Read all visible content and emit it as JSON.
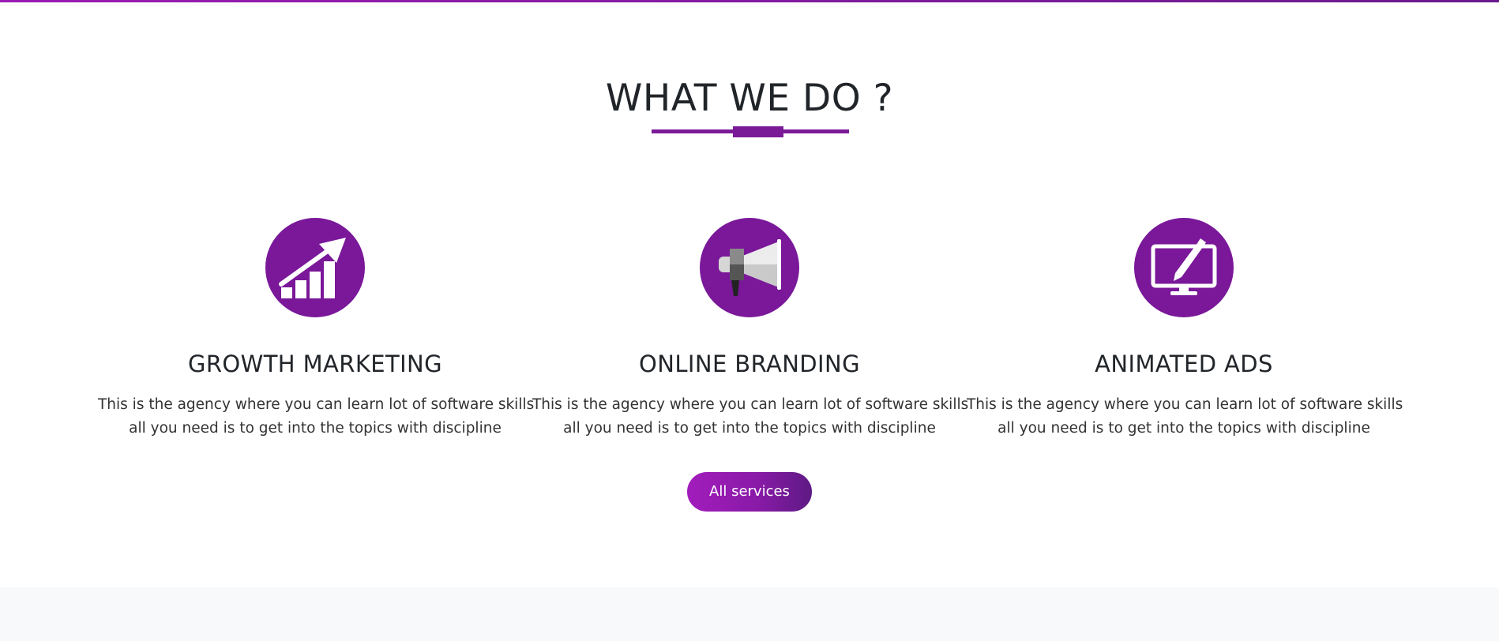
{
  "section": {
    "title": "WHAT WE DO ?"
  },
  "services": [
    {
      "icon": "growth-chart-icon",
      "title": "GROWTH MARKETING",
      "desc_line1": "This is the agency where you can learn lot of software skills",
      "desc_line2": "all you need is to get into the topics with discipline"
    },
    {
      "icon": "megaphone-icon",
      "title": "ONLINE BRANDING",
      "desc_line1": "This is the agency where you can learn lot of software skills",
      "desc_line2": "all you need is to get into the topics with discipline"
    },
    {
      "icon": "design-monitor-icon",
      "title": "ANIMATED ADS",
      "desc_line1": "This is the agency where you can learn lot of software skills",
      "desc_line2": "all you need is to get into the topics with discipline"
    }
  ],
  "cta": {
    "label": "All services"
  },
  "colors": {
    "accent": "#7a1899",
    "accent_light": "#a21cbc",
    "accent_dark": "#5e1a84",
    "text": "#212529",
    "footer_bg": "#f8f9fa"
  }
}
